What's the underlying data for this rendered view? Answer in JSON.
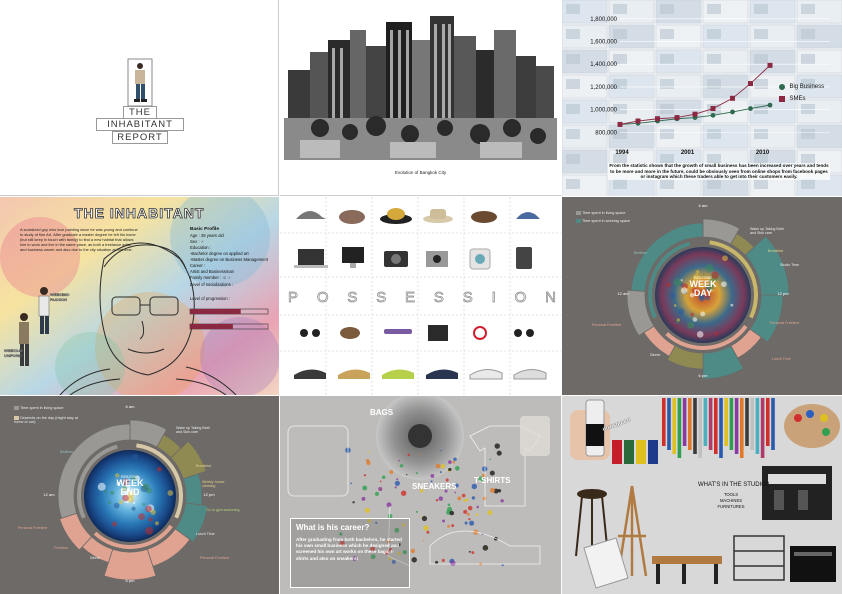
{
  "cover": {
    "title_line1": "THE",
    "title_line2": "INHABITANT",
    "title_line3": "REPORT"
  },
  "city": {
    "caption": "Evolution of Bangkok City"
  },
  "growth_chart": {
    "legend": [
      "Big Business",
      "SMEs"
    ],
    "description": "From the statistic shows that the growth of small business has been increased over years and tends to be more and more in the future, could be obviously seen from online shops from facebook pages or instagram which these traders able to get into their customers easily.",
    "chart_data": {
      "type": "line",
      "x": [
        "1994",
        "2001",
        "2010"
      ],
      "x_ticks": [
        "1994",
        "2001",
        "2010"
      ],
      "y_ticks": [
        "800,000",
        "1,000,000",
        "1,200,000",
        "1,400,000",
        "1,600,000",
        "1,800,000"
      ],
      "ylim": [
        680000,
        1860000
      ],
      "series": [
        {
          "name": "Big Business",
          "color": "#2e6a4e",
          "points": [
            [
              0.0,
              870000
            ],
            [
              0.12,
              880000
            ],
            [
              0.25,
              900000
            ],
            [
              0.38,
              920000
            ],
            [
              0.5,
              930000
            ],
            [
              0.62,
              950000
            ],
            [
              0.75,
              980000
            ],
            [
              0.87,
              1010000
            ],
            [
              1.0,
              1040000
            ]
          ]
        },
        {
          "name": "SMEs",
          "color": "#8b2942",
          "points": [
            [
              0.0,
              870000
            ],
            [
              0.12,
              900000
            ],
            [
              0.25,
              920000
            ],
            [
              0.38,
              930000
            ],
            [
              0.5,
              960000
            ],
            [
              0.62,
              1010000
            ],
            [
              0.75,
              1100000
            ],
            [
              0.87,
              1230000
            ],
            [
              1.0,
              1390000
            ]
          ]
        }
      ]
    }
  },
  "profile": {
    "header": "THE INHABITANT",
    "intro": "A socialized guy who love painting since he was young and continue to study of fine Art. After graduate a master degree he left his home (but still keep in touch with family) to find a new habitat that allows him to work and live in the same place, as both a freelance artist and business owner and also due to the city situation at that time.",
    "basic_title": "Basic Profile",
    "age": "Age : 28 years old",
    "sex": "Sex :",
    "education_title": "Education :",
    "edu1": "-Bachelor degree on applied art",
    "edu2": "-Master degree on Business Management",
    "career_title": "Career :",
    "career": "Artist and Businessman",
    "family": "Family member :",
    "socialization": "Level of socializations :",
    "progression": "Level of progression :",
    "weekend_label": "WEEKEND FASHION",
    "weekday_label": "WEEKDAY UNIFORM"
  },
  "possession": {
    "word": [
      "P",
      "O",
      "S",
      "S",
      "E",
      "S",
      "S",
      "I",
      "O",
      "N"
    ]
  },
  "weekday": {
    "legend1": "Time spent in living space",
    "legend2": "Time spent in working space",
    "center_top": "ROUTINE",
    "center_main_1": "WEEK",
    "center_main_2": "DAY",
    "t6am": "6 am",
    "t12pm": "12 pm",
    "t6pm": "6 pm",
    "t12am": "12 am",
    "labels": [
      "Wake up Taking Bath and Skin care",
      "Breakfast",
      "Studio Time",
      "Personal Freetime",
      "Lunch Time",
      "Personal Freetime",
      "Dinner",
      "Bedtime"
    ]
  },
  "weekend": {
    "legend1": "Time spent in living space",
    "legend2": "Depends on the day (might stay at home or out)",
    "center_top": "ROUTINE",
    "center_main_1": "WEEK",
    "center_main_2": "END",
    "t6am": "6 am",
    "t12pm": "12 pm",
    "t6pm": "6 pm",
    "t12am": "12 am",
    "labels": [
      "Wake up Taking Bath and Skin care",
      "Breakfast",
      "Weekly house cleaning",
      "Go to gym swimming",
      "Lunch Time",
      "Personal Freetime",
      "Freetime",
      "Personal Freetime",
      "Dinner",
      "Bedtime"
    ]
  },
  "career": {
    "bags": "BAGS",
    "sneakers": "SNEAKERS",
    "tshirts": "T-SHIRTS",
    "question": "What is his career?",
    "answer": "After graduating from both bachelors, he started his own small business which he designed and screened his own art works on these bags, t-shirts and also on sneakers!"
  },
  "studio": {
    "question": "WHAT'S IN THE STUDIO?",
    "items": [
      "TOOLS",
      "MACHINES",
      "FURNITURES"
    ],
    "can_label": "dowsguard"
  },
  "colors": {
    "panel_gray": "#6d6a67",
    "ring_teal": "#4e8a86",
    "ring_salmon": "#e0a391",
    "ring_olive": "#8f8a52",
    "ring_gray": "#9a9894",
    "sme": "#8b2942",
    "big": "#2e6a4e"
  }
}
